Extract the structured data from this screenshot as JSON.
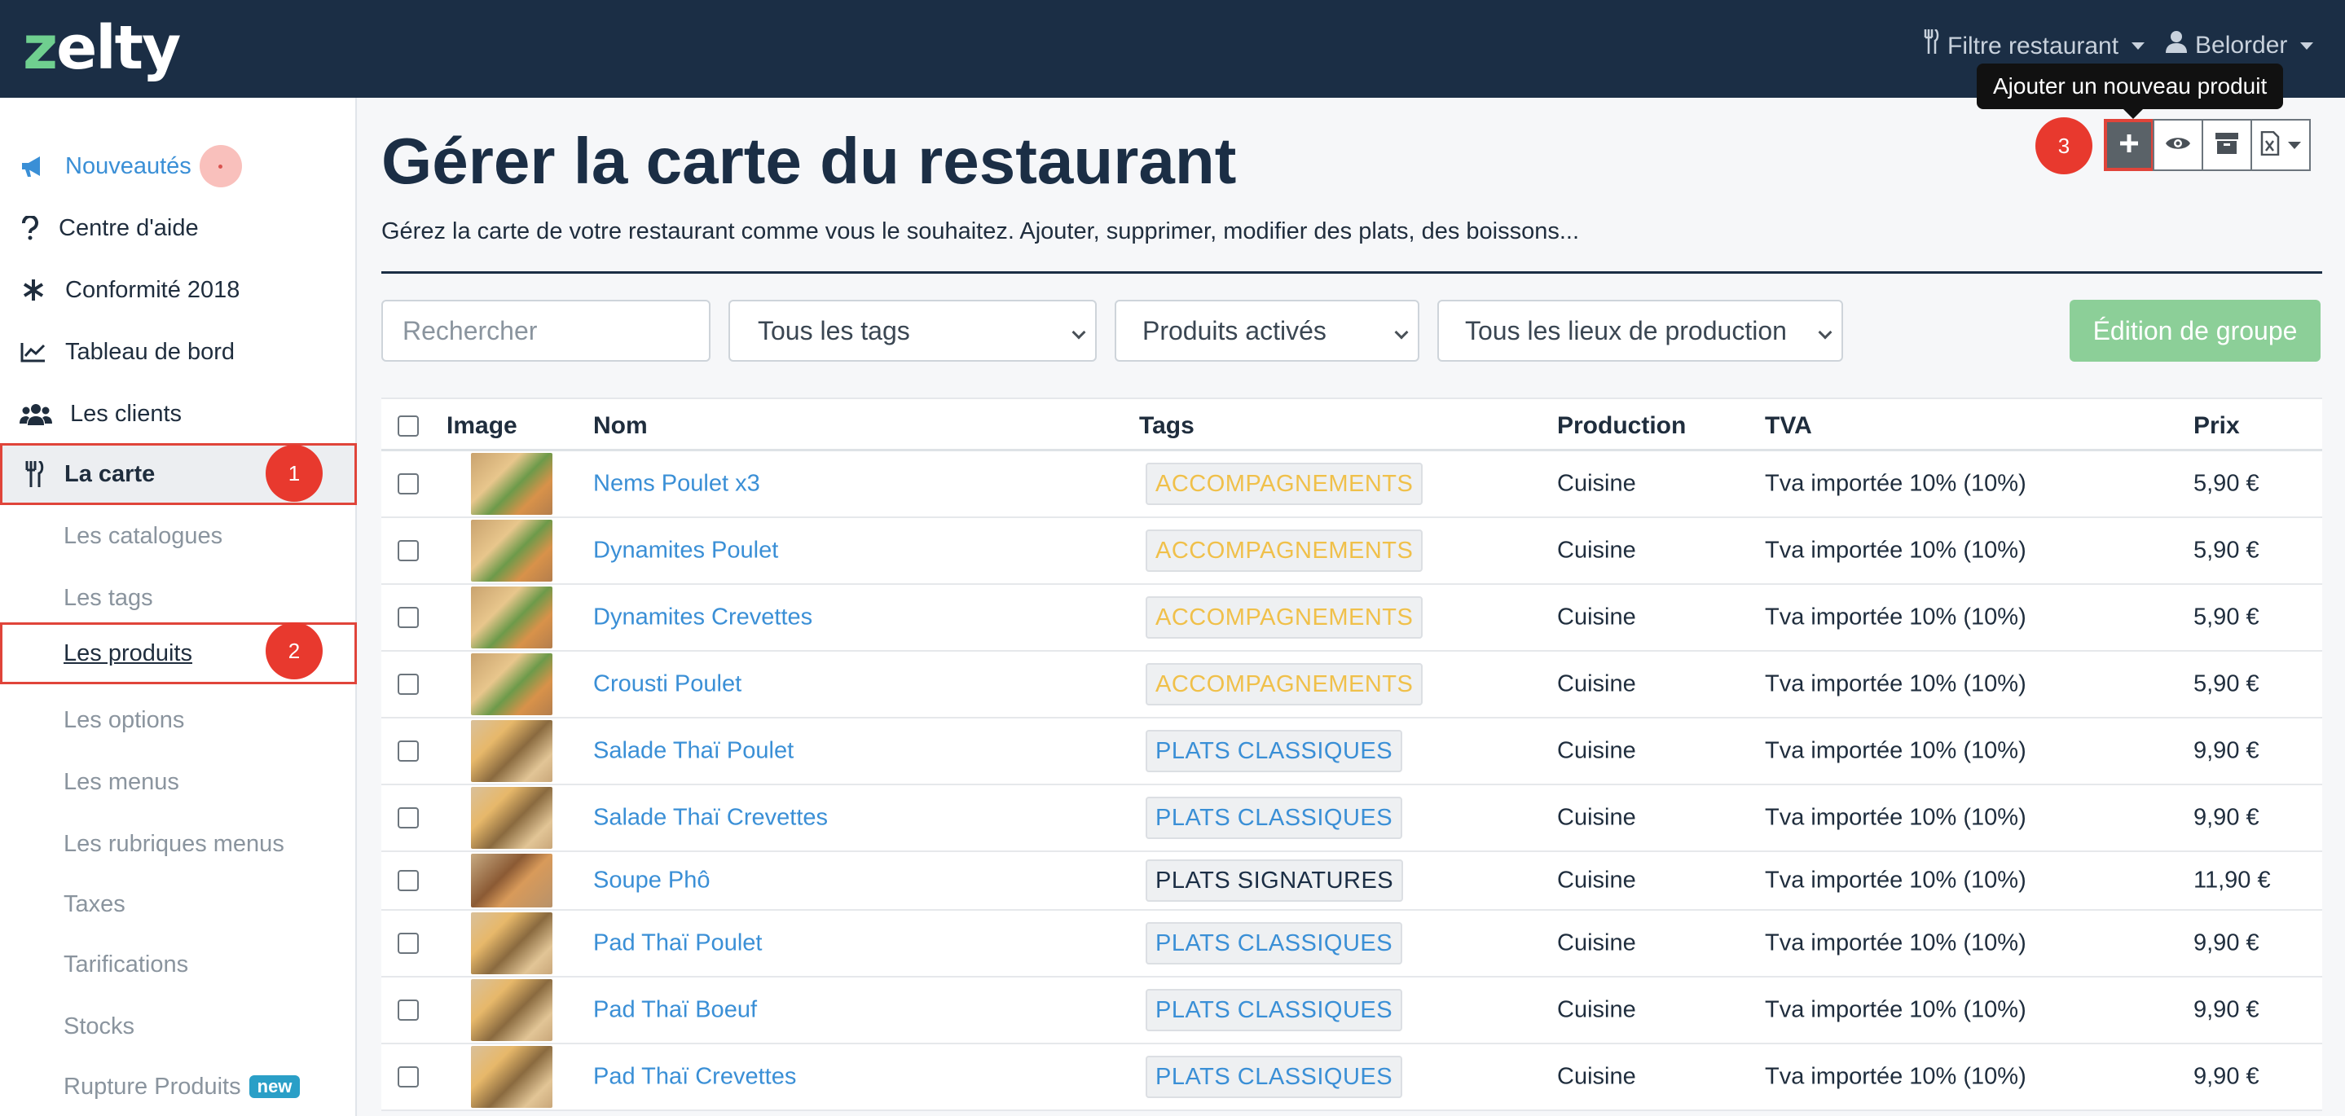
{
  "topbar": {
    "logo": "zelty",
    "restaurant_filter": "Filtre restaurant",
    "user": "Belorder"
  },
  "sidebar": {
    "items": [
      {
        "label": "Nouveautés",
        "icon": "megaphone-icon"
      },
      {
        "label": "Centre d'aide",
        "icon": "question-icon"
      },
      {
        "label": "Conformité 2018",
        "icon": "asterisk-icon"
      },
      {
        "label": "Tableau de bord",
        "icon": "chart-line-icon"
      },
      {
        "label": "Les clients",
        "icon": "users-icon"
      },
      {
        "label": "La carte",
        "icon": "utensils-icon"
      }
    ],
    "subitems": [
      "Les catalogues",
      "Les tags",
      "Les produits",
      "Les options",
      "Les menus",
      "Les rubriques menus",
      "Taxes",
      "Tarifications",
      "Stocks",
      "Rupture Produits"
    ],
    "new_badge": "new"
  },
  "steps": [
    "1",
    "2",
    "3"
  ],
  "page": {
    "title": "Gérer la carte du restaurant",
    "subtitle": "Gérez la carte de votre restaurant comme vous le souhaitez. Ajouter, supprimer, modifier des plats, des boissons..."
  },
  "toolbar": {
    "tooltip": "Ajouter un nouveau produit",
    "buttons": [
      "plus-icon",
      "eye-icon",
      "archive-icon",
      "excel-export-icon"
    ]
  },
  "filters": {
    "search_placeholder": "Rechercher",
    "tags": "Tous les tags",
    "status": "Produits activés",
    "production": "Tous les lieux de production",
    "group_edit": "Édition de groupe"
  },
  "table": {
    "headers": {
      "image": "Image",
      "name": "Nom",
      "tags": "Tags",
      "production": "Production",
      "tva": "TVA",
      "price": "Prix"
    },
    "rows": [
      {
        "name": "Nems Poulet x3",
        "tag": "ACCOMPAGNEMENTS",
        "production": "Cuisine",
        "tva": "Tva importée 10% (10%)",
        "price": "5,90 €"
      },
      {
        "name": "Dynamites Poulet",
        "tag": "ACCOMPAGNEMENTS",
        "production": "Cuisine",
        "tva": "Tva importée 10% (10%)",
        "price": "5,90 €"
      },
      {
        "name": "Dynamites Crevettes",
        "tag": "ACCOMPAGNEMENTS",
        "production": "Cuisine",
        "tva": "Tva importée 10% (10%)",
        "price": "5,90 €"
      },
      {
        "name": "Crousti Poulet",
        "tag": "ACCOMPAGNEMENTS",
        "production": "Cuisine",
        "tva": "Tva importée 10% (10%)",
        "price": "5,90 €"
      },
      {
        "name": "Salade Thaï Poulet",
        "tag": "PLATS CLASSIQUES",
        "production": "Cuisine",
        "tva": "Tva importée 10% (10%)",
        "price": "9,90 €"
      },
      {
        "name": "Salade Thaï Crevettes",
        "tag": "PLATS CLASSIQUES",
        "production": "Cuisine",
        "tva": "Tva importée 10% (10%)",
        "price": "9,90 €"
      },
      {
        "name": "Soupe Phô",
        "tag": "PLATS SIGNATURES",
        "production": "Cuisine",
        "tva": "Tva importée 10% (10%)",
        "price": "11,90 €"
      },
      {
        "name": "Pad Thaï Poulet",
        "tag": "PLATS CLASSIQUES",
        "production": "Cuisine",
        "tva": "Tva importée 10% (10%)",
        "price": "9,90 €"
      },
      {
        "name": "Pad Thaï Boeuf",
        "tag": "PLATS CLASSIQUES",
        "production": "Cuisine",
        "tva": "Tva importée 10% (10%)",
        "price": "9,90 €"
      },
      {
        "name": "Pad Thaï Crevettes",
        "tag": "PLATS CLASSIQUES",
        "production": "Cuisine",
        "tva": "Tva importée 10% (10%)",
        "price": "9,90 €"
      }
    ]
  },
  "colors": {
    "topbar": "#1b2e45",
    "link": "#3a8fd6",
    "tag_accompagnements": "#f0c04a",
    "tag_plats_classiques": "#3a8fd6",
    "tag_plats_signatures": "#1b2e45",
    "step_marker": "#e8392e",
    "group_button": "#8ccf98"
  }
}
